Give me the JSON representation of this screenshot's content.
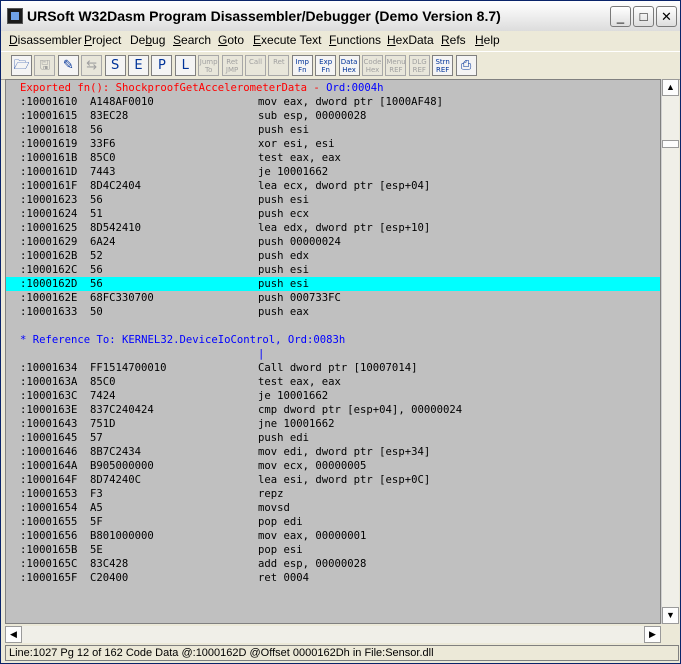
{
  "window": {
    "title": "URSoft W32Dasm Program Disassembler/Debugger (Demo Version 8.7)",
    "minimize_glyph": "_",
    "maximize_glyph": "□",
    "close_glyph": "✕"
  },
  "menu": [
    {
      "label": "Disassembler",
      "accel": "D"
    },
    {
      "label": "Project",
      "accel": "P"
    },
    {
      "label": "Debug",
      "accel": "b"
    },
    {
      "label": "Search",
      "accel": "S"
    },
    {
      "label": "Goto",
      "accel": "G"
    },
    {
      "label": "Execute Text",
      "accel": "E"
    },
    {
      "label": "Functions",
      "accel": "F"
    },
    {
      "label": "HexData",
      "accel": "H"
    },
    {
      "label": "Refs",
      "accel": "R"
    },
    {
      "label": "Help",
      "accel": "H"
    }
  ],
  "toolbar": {
    "buttons": [
      {
        "l1": "",
        "l2": "",
        "icon": "open-file-icon",
        "enabled": true
      },
      {
        "l1": "",
        "l2": "",
        "icon": "save-icon",
        "enabled": false
      },
      {
        "l1": "",
        "l2": "",
        "icon": "font-icon",
        "enabled": true
      },
      {
        "l1": "",
        "l2": "",
        "icon": "jump-code-icon",
        "enabled": false
      },
      {
        "l1": "",
        "l2": "",
        "icon": "goto-start-icon",
        "enabled": true
      },
      {
        "l1": "",
        "l2": "",
        "icon": "goto-entry-point-icon",
        "enabled": true
      },
      {
        "l1": "",
        "l2": "",
        "icon": "goto-page-icon",
        "enabled": true
      },
      {
        "l1": "",
        "l2": "",
        "icon": "goto-location-icon",
        "enabled": true
      },
      {
        "l1": "Jump",
        "l2": "To",
        "icon": "jump-to-icon",
        "enabled": false
      },
      {
        "l1": "Ret",
        "l2": "JMP",
        "icon": "return-jump-icon",
        "enabled": false
      },
      {
        "l1": "Call",
        "l2": "",
        "icon": "call-icon",
        "enabled": false
      },
      {
        "l1": "Ret",
        "l2": "",
        "icon": "return-call-icon",
        "enabled": false
      },
      {
        "l1": "Imp",
        "l2": "Fn",
        "icon": "imports-icon",
        "enabled": true
      },
      {
        "l1": "Exp",
        "l2": "Fn",
        "icon": "exports-icon",
        "enabled": true
      },
      {
        "l1": "Data",
        "l2": "Hex",
        "icon": "hex-data-icon",
        "enabled": true
      },
      {
        "l1": "Code",
        "l2": "Hex",
        "icon": "hex-code-icon",
        "enabled": false
      },
      {
        "l1": "Menu",
        "l2": "REF",
        "icon": "menu-ref-icon",
        "enabled": false
      },
      {
        "l1": "DLG",
        "l2": "REF",
        "icon": "dialog-ref-icon",
        "enabled": false
      },
      {
        "l1": "Strn",
        "l2": "REF",
        "icon": "string-ref-icon",
        "enabled": true
      },
      {
        "l1": "",
        "l2": "",
        "icon": "print-icon",
        "enabled": true
      }
    ]
  },
  "code": [
    {
      "kind": "exported",
      "text": "Exported fn(): ShockproofGetAccelerometerData - ",
      "ord": "Ord:0004h"
    },
    {
      "kind": "code",
      "addr": ":10001610",
      "bytes": "A148AF0010",
      "ins": "mov eax, dword ptr [1000AF48]"
    },
    {
      "kind": "code",
      "addr": ":10001615",
      "bytes": "83EC28",
      "ins": "sub esp, 00000028"
    },
    {
      "kind": "code",
      "addr": ":10001618",
      "bytes": "56",
      "ins": "push esi"
    },
    {
      "kind": "code",
      "addr": ":10001619",
      "bytes": "33F6",
      "ins": "xor esi, esi"
    },
    {
      "kind": "code",
      "addr": ":1000161B",
      "bytes": "85C0",
      "ins": "test eax, eax"
    },
    {
      "kind": "code",
      "addr": ":1000161D",
      "bytes": "7443",
      "ins": "je 10001662"
    },
    {
      "kind": "code",
      "addr": ":1000161F",
      "bytes": "8D4C2404",
      "ins": "lea ecx, dword ptr [esp+04]"
    },
    {
      "kind": "code",
      "addr": ":10001623",
      "bytes": "56",
      "ins": "push esi"
    },
    {
      "kind": "code",
      "addr": ":10001624",
      "bytes": "51",
      "ins": "push ecx"
    },
    {
      "kind": "code",
      "addr": ":10001625",
      "bytes": "8D542410",
      "ins": "lea edx, dword ptr [esp+10]"
    },
    {
      "kind": "code",
      "addr": ":10001629",
      "bytes": "6A24",
      "ins": "push 00000024"
    },
    {
      "kind": "code",
      "addr": ":1000162B",
      "bytes": "52",
      "ins": "push edx"
    },
    {
      "kind": "code",
      "addr": ":1000162C",
      "bytes": "56",
      "ins": "push esi"
    },
    {
      "kind": "code",
      "addr": ":1000162D",
      "bytes": "56",
      "ins": "push esi",
      "highlight": true
    },
    {
      "kind": "code",
      "addr": ":1000162E",
      "bytes": "68FC330700",
      "ins": "push 000733FC"
    },
    {
      "kind": "code",
      "addr": ":10001633",
      "bytes": "50",
      "ins": "push eax"
    },
    {
      "kind": "blank"
    },
    {
      "kind": "ref",
      "text": "* Reference To: KERNEL32.DeviceIoControl, Ord:0083h"
    },
    {
      "kind": "arrow",
      "text": "|"
    },
    {
      "kind": "code",
      "addr": ":10001634",
      "bytes": "FF1514700010",
      "ins": "Call dword ptr [10007014]"
    },
    {
      "kind": "code",
      "addr": ":1000163A",
      "bytes": "85C0",
      "ins": "test eax, eax"
    },
    {
      "kind": "code",
      "addr": ":1000163C",
      "bytes": "7424",
      "ins": "je 10001662"
    },
    {
      "kind": "code",
      "addr": ":1000163E",
      "bytes": "837C240424",
      "ins": "cmp dword ptr [esp+04], 00000024"
    },
    {
      "kind": "code",
      "addr": ":10001643",
      "bytes": "751D",
      "ins": "jne 10001662"
    },
    {
      "kind": "code",
      "addr": ":10001645",
      "bytes": "57",
      "ins": "push edi"
    },
    {
      "kind": "code",
      "addr": ":10001646",
      "bytes": "8B7C2434",
      "ins": "mov edi, dword ptr [esp+34]"
    },
    {
      "kind": "code",
      "addr": ":1000164A",
      "bytes": "B905000000",
      "ins": "mov ecx, 00000005"
    },
    {
      "kind": "code",
      "addr": ":1000164F",
      "bytes": "8D74240C",
      "ins": "lea esi, dword ptr [esp+0C]"
    },
    {
      "kind": "code",
      "addr": ":10001653",
      "bytes": "F3",
      "ins": "repz"
    },
    {
      "kind": "code",
      "addr": ":10001654",
      "bytes": "A5",
      "ins": "movsd"
    },
    {
      "kind": "code",
      "addr": ":10001655",
      "bytes": "5F",
      "ins": "pop edi"
    },
    {
      "kind": "code",
      "addr": ":10001656",
      "bytes": "B801000000",
      "ins": "mov eax, 00000001"
    },
    {
      "kind": "code",
      "addr": ":1000165B",
      "bytes": "5E",
      "ins": "pop esi"
    },
    {
      "kind": "code",
      "addr": ":1000165C",
      "bytes": "83C428",
      "ins": "add esp, 00000028"
    },
    {
      "kind": "code",
      "addr": ":1000165F",
      "bytes": "C20400",
      "ins": "ret 0004"
    }
  ],
  "scroll": {
    "up_glyph": "▲",
    "down_glyph": "▼",
    "left_glyph": "◀",
    "right_glyph": "▶",
    "vertical_position": 0.09
  },
  "status": {
    "text": "Line:1027 Pg 12 of 162  Code Data @:1000162D @Offset 0000162Dh in File:Sensor.dll"
  },
  "colors": {
    "highlight": "#00ffff",
    "export_text": "#ff0000",
    "reference_text": "#0000ff",
    "code_background": "#c0c0c0"
  }
}
